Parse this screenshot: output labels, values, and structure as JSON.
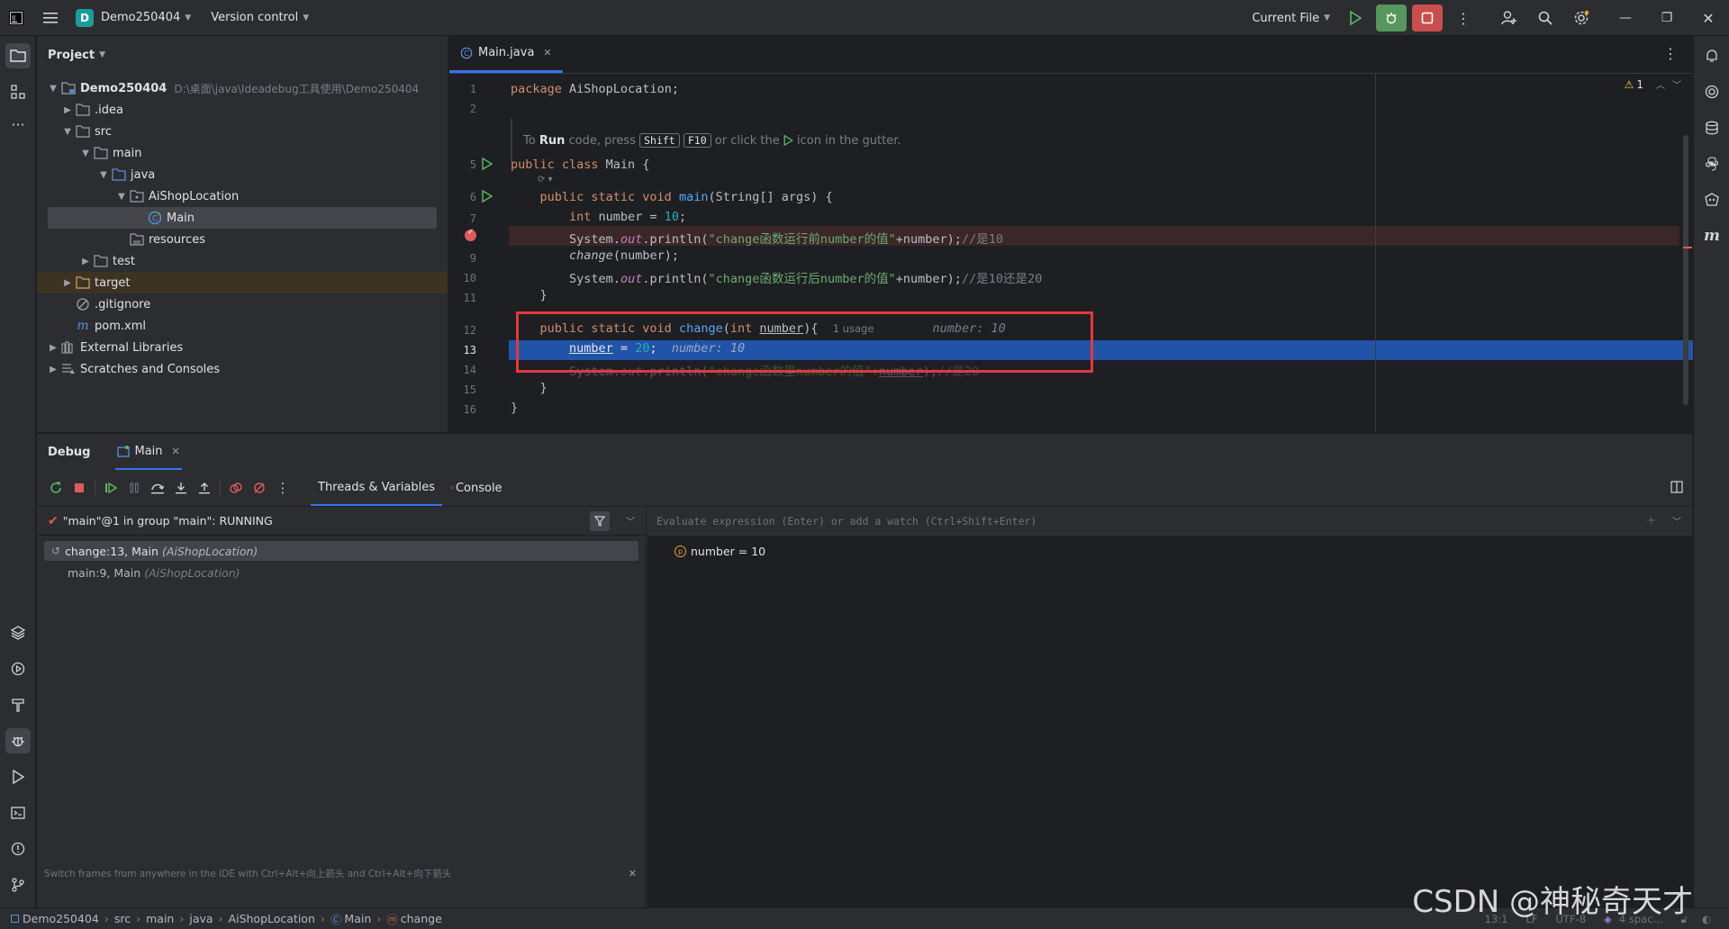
{
  "titlebar": {
    "project_badge": "D",
    "project_name": "Demo250404",
    "vcs": "Version control",
    "run_config": "Current File"
  },
  "project_panel": {
    "title": "Project",
    "tree": [
      {
        "label": "Demo250404",
        "path": "D:\\桌面\\java\\Ideadebug工具使用\\Demo250404"
      },
      {
        "label": ".idea"
      },
      {
        "label": "src"
      },
      {
        "label": "main"
      },
      {
        "label": "java"
      },
      {
        "label": "AiShopLocation"
      },
      {
        "label": "Main"
      },
      {
        "label": "resources"
      },
      {
        "label": "test"
      },
      {
        "label": "target"
      },
      {
        "label": ".gitignore"
      },
      {
        "label": "pom.xml"
      },
      {
        "label": "External Libraries"
      },
      {
        "label": "Scratches and Consoles"
      }
    ]
  },
  "editor": {
    "tab_label": "Main.java",
    "warnings_count": "1",
    "line_numbers": [
      "1",
      "2",
      "5",
      "6",
      "7",
      "8",
      "9",
      "10",
      "11",
      "12",
      "13",
      "14",
      "15",
      "16"
    ],
    "run_hint": {
      "prefix": "To ",
      "run": "Run",
      "mid": " code, press ",
      "key1": "Shift",
      "key2": "F10",
      "suffix": " or click the ",
      "end": " icon in the gutter."
    },
    "code": {
      "l1_kw": "package",
      "l1_rest": " AiShopLocation;",
      "l5_kw": "public class",
      "l5_rest": " Main {",
      "l6_kw": "public static void",
      "l6_fn": "main",
      "l6_rest": "(String[] args) {",
      "l7_kw": "int",
      "l7_mid": " number = ",
      "l7_num": "10",
      "l7_end": ";",
      "l8_a": "System.",
      "l8_out": "out",
      "l8_b": ".println(",
      "l8_str": "\"change函数运行前number的值\"",
      "l8_c": "+number);",
      "l8_cmt": "//是10",
      "l9_fn": "change",
      "l9_rest": "(number);",
      "l10_a": "System.",
      "l10_out": "out",
      "l10_b": ".println(",
      "l10_str": "\"change函数运行后number的值\"",
      "l10_c": "+number);",
      "l10_cmt": "//是10还是20",
      "l11": "}",
      "l12_kw": "public static void",
      "l12_fn": "change",
      "l12_a": "(",
      "l12_kw2": "int",
      "l12_param": "number",
      "l12_b": "){",
      "l12_usage": "1 usage",
      "l12_hint": "number: 10",
      "l13_var": "number",
      "l13_eq": " = ",
      "l13_num": "20",
      "l13_end": ";",
      "l13_hint": "number: 10",
      "l14_a": "System.",
      "l14_out": "out",
      "l14_b": ".println(",
      "l14_str": "\"change函数里number的值\"",
      "l14_c": "+",
      "l14_var": "number",
      "l14_d": ");",
      "l14_cmt": "//是20",
      "l15": "}",
      "l16": "}"
    }
  },
  "debug": {
    "title": "Debug",
    "session_tab": "Main",
    "tabs": [
      "Threads & Variables",
      "Console"
    ],
    "thread": "\"main\"@1 in group \"main\": RUNNING",
    "frames": [
      {
        "method": "change:13, Main",
        "class": "(AiShopLocation)"
      },
      {
        "method": "main:9, Main",
        "class": "(AiShopLocation)"
      }
    ],
    "frames_hint": "Switch frames from anywhere in the IDE with Ctrl+Alt+向上箭头 and Ctrl+Alt+向下箭头",
    "eval_placeholder": "Evaluate expression (Enter) or add a watch (Ctrl+Shift+Enter)",
    "variables": [
      {
        "name": "number",
        "value": " = 10"
      }
    ]
  },
  "statusbar": {
    "crumbs": [
      "Demo250404",
      "src",
      "main",
      "java",
      "AiShopLocation",
      "Main",
      "change"
    ],
    "position": "13:1",
    "line_sep": "LF",
    "encoding": "UTF-8",
    "indent": "4 spac..."
  },
  "watermark": "CSDN @神秘奇天才",
  "colors": {
    "accent": "#3574f0",
    "breakpoint": "#db5c5c",
    "highlight_box": "#e5383b",
    "run_green": "#5fb865"
  }
}
